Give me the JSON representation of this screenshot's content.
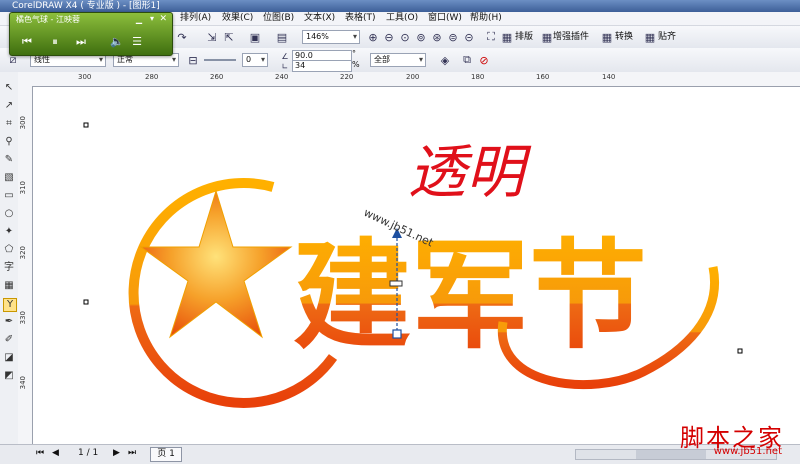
{
  "window": {
    "title": "CorelDRAW X4 ( 专业版 ) - [图形1]"
  },
  "player": {
    "title": "橘色气球 - 江映蓉",
    "buttons": [
      "prev",
      "pause",
      "next",
      "volume",
      "playlist"
    ]
  },
  "menu": {
    "items": [
      "排列(A)",
      "效果(C)",
      "位图(B)",
      "文本(X)",
      "表格(T)",
      "工具(O)",
      "窗口(W)",
      "帮助(H)"
    ]
  },
  "toolbar1": {
    "zoom": "146%",
    "typeset_label": "排版",
    "plugin_label": "增强插件",
    "convert_label": "转换",
    "snap_label": "贴齐"
  },
  "toolbar2": {
    "transparency_type": "线性",
    "merge_mode": "正常",
    "edge_value": "0",
    "angle_value": "90.0",
    "angle_unit": "°",
    "edge_pad_value": "34",
    "edge_pad_unit": "%",
    "target": "全部"
  },
  "ruler_top": {
    "labels": [
      "300",
      "280",
      "260",
      "240",
      "220",
      "200",
      "180",
      "160",
      "140"
    ]
  },
  "ruler_left": {
    "labels": [
      "300",
      "310",
      "320",
      "330",
      "340"
    ]
  },
  "artwork": {
    "main_text": "建军节",
    "handwritten_annotation": "透明",
    "watermark_on_canvas": "www.jb51.net",
    "gradient_top_color": "#ffb000",
    "gradient_bottom_color": "#e8400a",
    "annotation_color": "#e0101a"
  },
  "statusbar": {
    "page_count": "1 / 1",
    "page_tab": "页 1"
  },
  "watermark": {
    "brand": "脚本之家",
    "url": "www.jb51.net"
  }
}
